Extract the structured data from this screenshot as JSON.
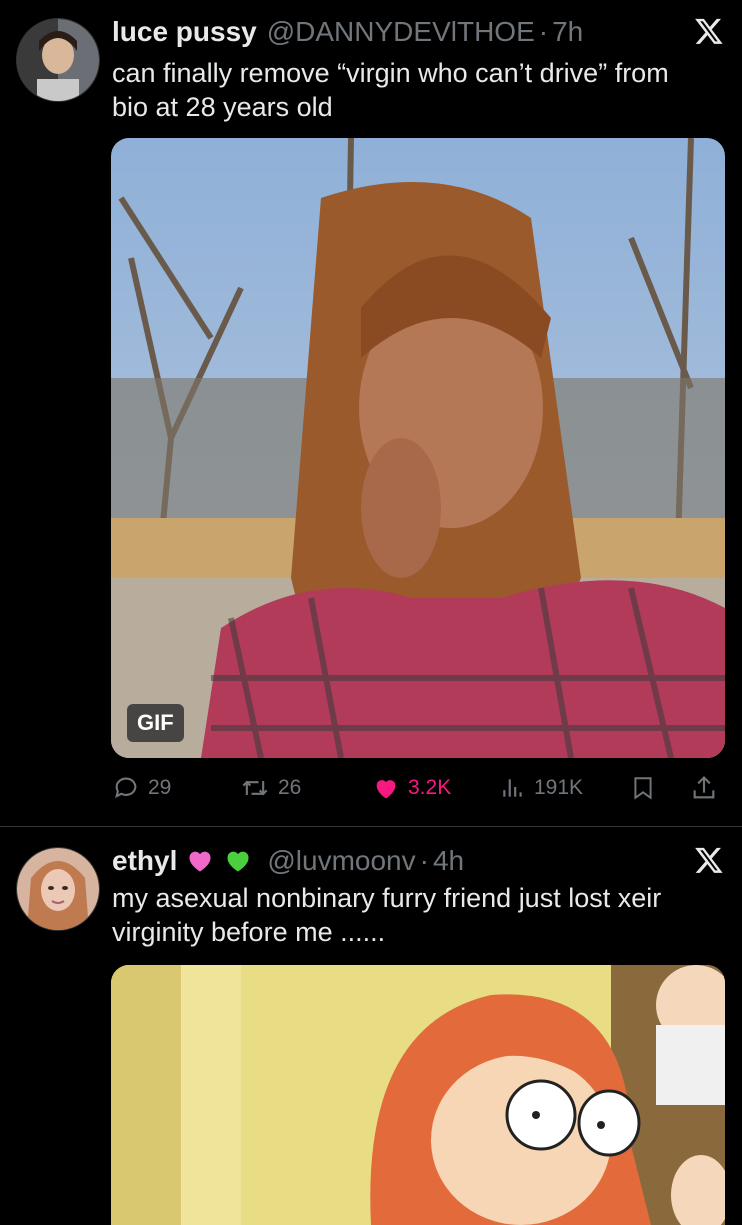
{
  "tweets": [
    {
      "name": "luce pussy",
      "handle": "@DANNYDEVlTHOE",
      "separator": "·",
      "time": "7h",
      "text": "can finally remove “virgin who can’t drive” from bio at 28 years old",
      "media_badge": "GIF",
      "stats": {
        "replies": "29",
        "reposts": "26",
        "likes": "3.2K",
        "views": "191K"
      },
      "liked": true
    },
    {
      "name": "ethyl",
      "name_emojis": [
        "pink-heart-icon",
        "green-heart-icon"
      ],
      "handle": "@luvmoonv",
      "separator": "·",
      "time": "4h",
      "text": "my asexual nonbinary furry friend just lost xeir virginity before me ......"
    }
  ],
  "colors": {
    "background": "#000000",
    "text": "#e7e9ea",
    "muted": "#71767b",
    "like": "#f91880",
    "divider": "#2f3336"
  }
}
